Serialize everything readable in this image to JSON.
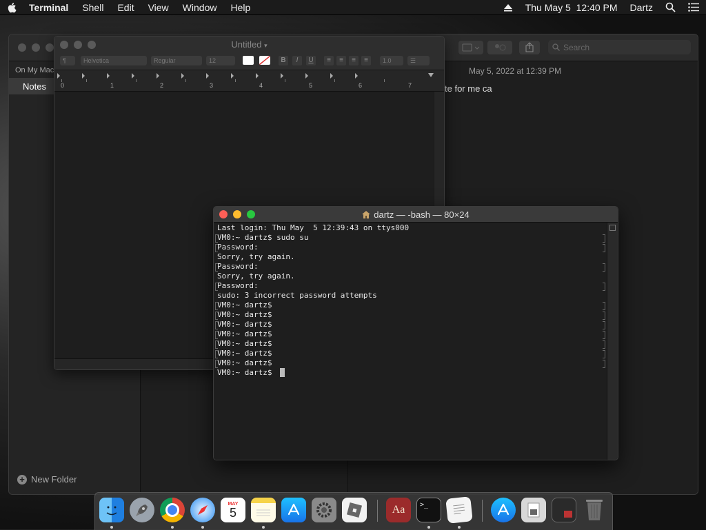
{
  "menubar": {
    "app_name": "Terminal",
    "menus": [
      "Shell",
      "Edit",
      "View",
      "Window",
      "Help"
    ],
    "clock": "Thu May 5  12:40 PM",
    "user": "Dartz"
  },
  "notes": {
    "section": "On My Mac",
    "selected_folder": "Notes",
    "new_folder": "New Folder",
    "note_date": "May 5, 2022 at 12:39 PM",
    "note_snippet": "te for me ca",
    "search_placeholder": "Search"
  },
  "textedit": {
    "title": "Untitled",
    "font_family": "Helvetica",
    "font_style": "Regular",
    "font_size": "12",
    "line_spacing": "1.0",
    "ruler_numbers": [
      "0",
      "1",
      "2",
      "3",
      "4",
      "5",
      "6",
      "7"
    ],
    "fmt_bold": "B",
    "fmt_italic": "I",
    "fmt_underline": "U"
  },
  "terminal": {
    "title": "dartz — -bash — 80×24",
    "lines": [
      "Last login: Thu May  5 12:39:43 on ttys000",
      "VM0:~ dartz$ sudo su",
      "Password:",
      "Sorry, try again.",
      "Password:",
      "Sorry, try again.",
      "Password:",
      "sudo: 3 incorrect password attempts",
      "VM0:~ dartz$",
      "VM0:~ dartz$",
      "VM0:~ dartz$",
      "VM0:~ dartz$",
      "VM0:~ dartz$",
      "VM0:~ dartz$",
      "VM0:~ dartz$",
      "VM0:~ dartz$ "
    ]
  },
  "dock": {
    "icons": [
      "finder-icon",
      "launchpad-icon",
      "chrome-icon",
      "safari-icon",
      "calendar-icon",
      "notes-icon",
      "app-store-icon",
      "system-preferences-icon",
      "roblox-icon",
      "dictionary-icon",
      "terminal-icon",
      "textedit-icon",
      "app-store-downloads-icon",
      "preview-icon",
      "screenshot-icon",
      "trash-icon"
    ],
    "calendar_month": "MAY",
    "calendar_day": "5",
    "dictionary_label": "Aa",
    "terminal_prompt": ">_"
  }
}
